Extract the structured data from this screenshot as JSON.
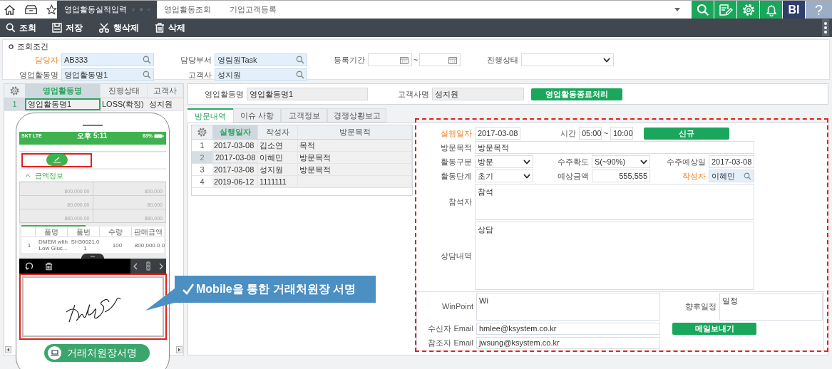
{
  "tabs": [
    {
      "label": "영업활동실적입력",
      "selected": true
    },
    {
      "label": "영업활동조회",
      "selected": false
    },
    {
      "label": "기업고객등록",
      "selected": false
    }
  ],
  "header_buttons": [
    {
      "kind": "search"
    },
    {
      "kind": "edit"
    },
    {
      "kind": "gear"
    },
    {
      "kind": "bell"
    },
    {
      "kind": "text",
      "label": "BI"
    },
    {
      "kind": "help",
      "label": "?"
    }
  ],
  "toolbar": [
    {
      "kind": "search",
      "label": "조회"
    },
    {
      "kind": "save",
      "label": "저장"
    },
    {
      "kind": "cut",
      "label": "행삭제"
    },
    {
      "kind": "trash",
      "label": "삭제"
    }
  ],
  "search_panel": {
    "title": "조회조건",
    "rows": [
      [
        {
          "kind": "lookup",
          "label": "담당자",
          "required": true,
          "value": "AB333"
        },
        {
          "kind": "lookup",
          "label": "담당부서",
          "required": false,
          "value": "영림원Task"
        },
        {
          "kind": "daterange",
          "label": "등록기간",
          "required": false,
          "separator": "~"
        },
        {
          "kind": "select",
          "label": "진행상태",
          "required": false
        }
      ],
      [
        {
          "kind": "lookup",
          "label": "영업활동명",
          "required": false,
          "value": "영업활동명1"
        },
        {
          "kind": "lookup",
          "label": "고객사",
          "required": false,
          "value": "성지원"
        }
      ]
    ]
  },
  "activity_grid": {
    "columns": [
      {
        "label": "영업활동명",
        "selected": true
      },
      {
        "label": "진행상태",
        "selected": false
      },
      {
        "label": "고객사",
        "selected": false
      }
    ],
    "rows": [
      {
        "number": "1",
        "selected": true,
        "cells": [
          "영업활동명1",
          "LOSS(확정)",
          "성지원"
        ]
      }
    ]
  },
  "detail_header": {
    "fields": [
      {
        "label": "영업활동명",
        "value": "영업활동명1"
      },
      {
        "label": "고객사명",
        "value": "성지원"
      }
    ],
    "button": "영업활동종료처리"
  },
  "detail_tabs": [
    {
      "label": "방문내역",
      "selected": true
    },
    {
      "label": "이슈 사항",
      "selected": false
    },
    {
      "label": "고객정보",
      "selected": false
    },
    {
      "label": "경쟁상황보고",
      "selected": false
    }
  ],
  "visit_grid": {
    "columns": [
      {
        "label": "실행일자",
        "selected": true
      },
      {
        "label": "작성자",
        "selected": false
      },
      {
        "label": "방문목적",
        "selected": false
      }
    ],
    "rows": [
      {
        "number": "1",
        "selected": false,
        "cells": [
          "2017-03-08",
          "김소연",
          "목적"
        ]
      },
      {
        "number": "2",
        "selected": true,
        "cells": [
          "2017-03-08",
          "이혜민",
          "방문목적"
        ]
      },
      {
        "number": "3",
        "selected": false,
        "cells": [
          "2017-03-08",
          "성지원",
          "방문목적"
        ]
      },
      {
        "number": "4",
        "selected": false,
        "cells": [
          "2019-06-12",
          "1111111",
          ""
        ]
      }
    ]
  },
  "visit_form": {
    "rows": [
      [
        {
          "kind": "date",
          "label": "실행일자",
          "required": true,
          "value": "2017-03-08"
        },
        {
          "kind": "timerange",
          "label": "시간",
          "required": false,
          "from": "05:00",
          "separator": "~",
          "to": "10:00"
        },
        {
          "kind": "button",
          "label": "신규"
        }
      ],
      [
        {
          "kind": "text",
          "label": "방문목적",
          "required": false,
          "value": "방문목적"
        }
      ],
      [
        {
          "kind": "select",
          "label": "활동구분",
          "required": false,
          "value": "방문"
        },
        {
          "kind": "select",
          "label": "수주확도",
          "required": false,
          "value": "S(~90%)"
        },
        {
          "kind": "date",
          "label": "수주예상일",
          "required": false,
          "value": "2017-03-08"
        }
      ],
      [
        {
          "kind": "select",
          "label": "활동단계",
          "required": false,
          "value": "초기"
        },
        {
          "kind": "number",
          "label": "예상금액",
          "required": false,
          "value": "555,555"
        },
        {
          "kind": "lookup",
          "label": "작성자",
          "required": true,
          "value": "이혜민"
        }
      ],
      [
        {
          "kind": "textarea",
          "label": "참석자",
          "required": false,
          "value": "참석"
        }
      ],
      [
        {
          "kind": "textarea",
          "label": "상담내역",
          "required": false,
          "value": "상담"
        }
      ]
    ],
    "footer": {
      "winpoint": {
        "label": "WinPoint",
        "value": "Wi"
      },
      "followup": {
        "label": "향후일정",
        "value": "일정"
      },
      "emails": [
        {
          "label": "수신자 Email",
          "value": "hmlee@ksystem.co.kr"
        },
        {
          "label": "참조자 Email",
          "value": "jwsung@ksystem.co.kr"
        }
      ],
      "button": "메일보내기"
    }
  },
  "phone": {
    "carrier": "SKT LTE",
    "time": "오후 5:11",
    "battery": "63%",
    "section": "금액정보",
    "amounts": [
      [
        "800,000.00",
        "800,000"
      ],
      [
        "80,000.00",
        "80,000"
      ],
      [
        "880,000.00",
        "880,000"
      ]
    ],
    "item_columns": [
      "품명",
      "품번",
      "수량",
      "판매금액"
    ],
    "item_rows": [
      [
        "1",
        "DMEM with Low Gluc...",
        "SH30021.0 1",
        "100",
        "800,000.0 0"
      ]
    ],
    "caption": "거래처원장서명"
  },
  "callout": "Mobile을 통한 거래처원장 서명"
}
